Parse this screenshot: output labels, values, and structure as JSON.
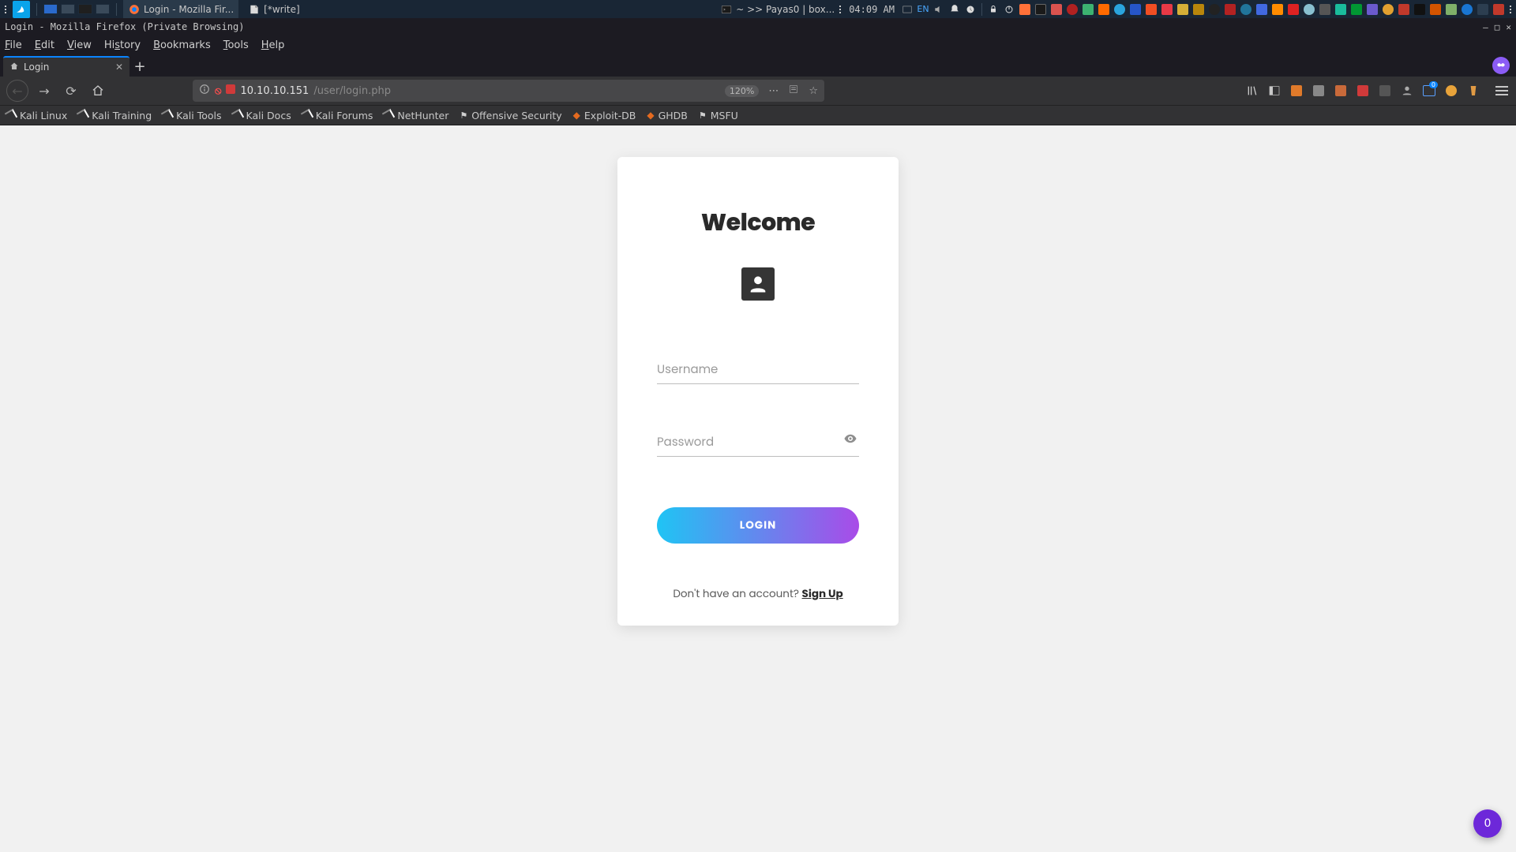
{
  "sys": {
    "task_ff": "Login - Mozilla Fir...",
    "task_editor": "[*write]",
    "task_term": "~ >> Payas0 | box...",
    "clock": "04:09 AM",
    "lang": "EN"
  },
  "ff": {
    "title": "Login - Mozilla Firefox (Private Browsing)",
    "menus": [
      "File",
      "Edit",
      "View",
      "History",
      "Bookmarks",
      "Tools",
      "Help"
    ],
    "tab_label": "Login",
    "url_host": "10.10.10.151",
    "url_path": "/user/login.php",
    "zoom": "120%",
    "bookmarks": [
      "Kali Linux",
      "Kali Training",
      "Kali Tools",
      "Kali Docs",
      "Kali Forums",
      "NetHunter",
      "Offensive Security",
      "Exploit-DB",
      "GHDB",
      "MSFU"
    ]
  },
  "page": {
    "welcome": "Welcome",
    "username_ph": "Username",
    "password_ph": "Password",
    "login_btn": "LOGIN",
    "signup_q": "Don't have an account? ",
    "signup_link": "Sign Up"
  },
  "float_badge": "0"
}
